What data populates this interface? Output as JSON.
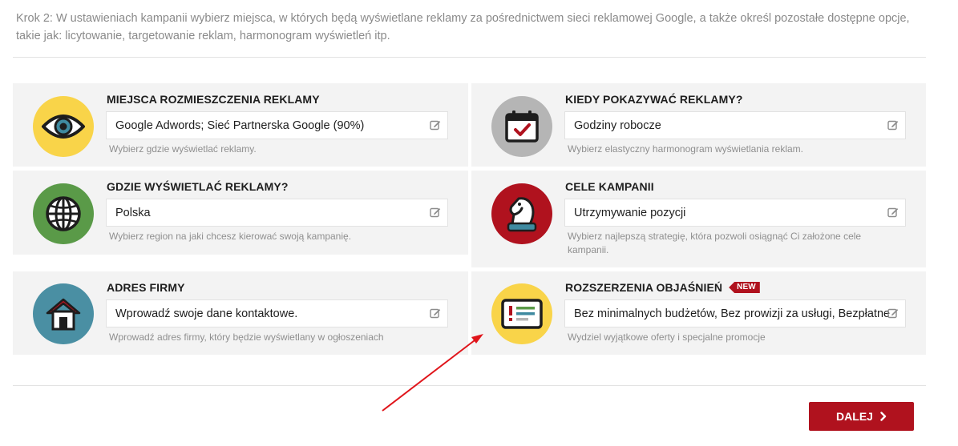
{
  "intro": "Krok 2: W ustawieniach kampanii wybierz miejsca, w których będą wyświetlane reklamy za pośrednictwem sieci reklamowej Google, a także określ pozostałe dostępne opcje, takie jak: licytowanie, targetowanie reklam, harmonogram wyświetleń itp.",
  "cards": {
    "placement": {
      "title": "MIEJSCA ROZMIESZCZENIA REKLAMY",
      "value": "Google Adwords; Sieć Partnerska Google (90%)",
      "hint": "Wybierz gdzie wyświetlać reklamy.",
      "icon": "eye-icon",
      "color": "#f9d449"
    },
    "schedule": {
      "title": "KIEDY POKAZYWAĆ REKLAMY?",
      "value": "Godziny robocze",
      "hint": "Wybierz elastyczny harmonogram wyświetlania reklam.",
      "icon": "calendar-check-icon",
      "color": "#b5b5b5"
    },
    "region": {
      "title": "GDZIE WYŚWIETLAĆ REKLAMY?",
      "value": "Polska",
      "hint": "Wybierz region na jaki chcesz kierować swoją kampanię.",
      "icon": "globe-icon",
      "color": "#5a9a48"
    },
    "goals": {
      "title": "CELE KAMPANII",
      "value": "Utrzymywanie pozycji",
      "hint": "Wybierz najlepszą strategię, która pozwoli osiągnąć Ci założone cele kampanii.",
      "icon": "chess-knight-icon",
      "color": "#b0121e"
    },
    "address": {
      "title": "ADRES FIRMY",
      "value": "Wprowadź swoje dane kontaktowe.",
      "hint": "Wprowadź adres firmy, który będzie wyświetlany w ogłoszeniach",
      "icon": "house-icon",
      "color": "#4a8fa3"
    },
    "callouts": {
      "title": "ROZSZERZENIA OBJAŚNIEŃ",
      "badge": "NEW",
      "value": "Bez minimalnych budżetów, Bez prowizji za usługi, Bezpłatne",
      "hint": "Wydziel wyjątkowe oferty i specjalne promocje",
      "icon": "callout-panel-icon",
      "color": "#f9d449"
    }
  },
  "next_label": "DALEJ",
  "colors": {
    "accent": "#b0121e",
    "card_bg": "#f3f3f3",
    "annotation_arrow": "#e0151b"
  }
}
